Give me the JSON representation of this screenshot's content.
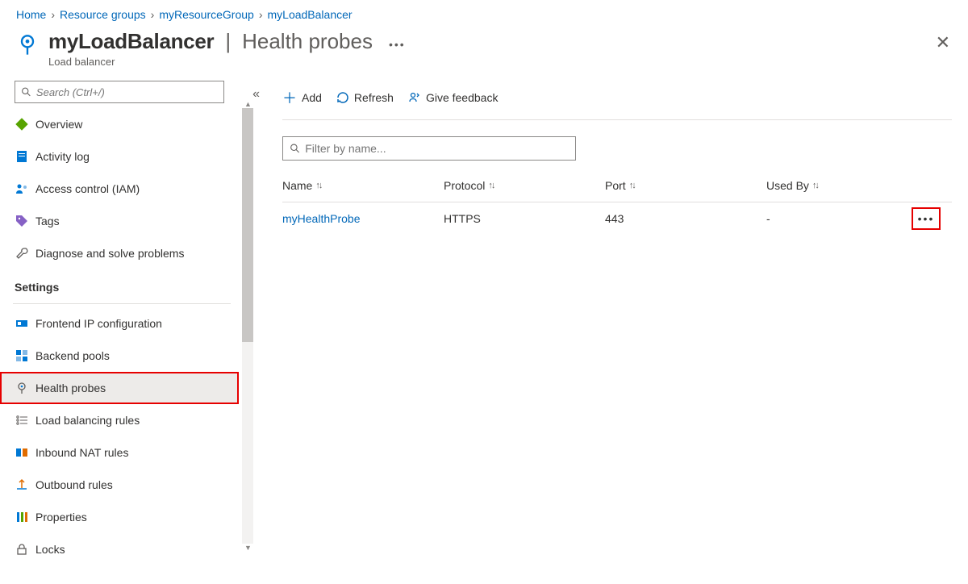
{
  "breadcrumb": [
    {
      "label": "Home"
    },
    {
      "label": "Resource groups"
    },
    {
      "label": "myResourceGroup"
    },
    {
      "label": "myLoadBalancer"
    }
  ],
  "header": {
    "resource_name": "myLoadBalancer",
    "blade_name": "Health probes",
    "subtitle": "Load balancer",
    "search_placeholder": "Search (Ctrl+/)"
  },
  "sidebar": {
    "top_items": [
      {
        "label": "Overview",
        "icon": "diamond"
      },
      {
        "label": "Activity log",
        "icon": "log"
      },
      {
        "label": "Access control (IAM)",
        "icon": "iam"
      },
      {
        "label": "Tags",
        "icon": "tag"
      },
      {
        "label": "Diagnose and solve problems",
        "icon": "wrench"
      }
    ],
    "settings_label": "Settings",
    "settings_items": [
      {
        "label": "Frontend IP configuration",
        "icon": "feip"
      },
      {
        "label": "Backend pools",
        "icon": "bepool"
      },
      {
        "label": "Health probes",
        "icon": "probe",
        "active": true
      },
      {
        "label": "Load balancing rules",
        "icon": "lbrules"
      },
      {
        "label": "Inbound NAT rules",
        "icon": "nat"
      },
      {
        "label": "Outbound rules",
        "icon": "outbound"
      },
      {
        "label": "Properties",
        "icon": "props"
      },
      {
        "label": "Locks",
        "icon": "lock"
      }
    ]
  },
  "toolbar": {
    "add_label": "Add",
    "refresh_label": "Refresh",
    "feedback_label": "Give feedback",
    "filter_placeholder": "Filter by name..."
  },
  "table": {
    "columns": [
      {
        "label": "Name"
      },
      {
        "label": "Protocol"
      },
      {
        "label": "Port"
      },
      {
        "label": "Used By"
      }
    ],
    "rows": [
      {
        "name": "myHealthProbe",
        "protocol": "HTTPS",
        "port": "443",
        "used_by": "-"
      }
    ]
  }
}
